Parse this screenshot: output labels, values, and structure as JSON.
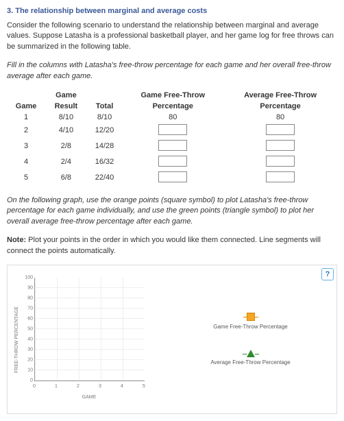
{
  "title": "3. The relationship between marginal and average costs",
  "intro": "Consider the following scenario to understand the relationship between marginal and average values. Suppose Latasha is a professional basketball player, and her game log for free throws can be summarized in the following table.",
  "fill_instr": "Fill in the columns with Latasha's free-throw percentage for each game and her overall free-throw average after each game.",
  "headers": {
    "game": "Game",
    "result_top": "Game",
    "result_bot": "Result",
    "total": "Total",
    "gpct_top": "Game Free-Throw",
    "gpct_bot": "Percentage",
    "apct_top": "Average Free-Throw",
    "apct_bot": "Percentage"
  },
  "rows": [
    {
      "game": "1",
      "result": "8/10",
      "total": "8/10",
      "gpct": "80",
      "apct": "80"
    },
    {
      "game": "2",
      "result": "4/10",
      "total": "12/20",
      "gpct": "",
      "apct": ""
    },
    {
      "game": "3",
      "result": "2/8",
      "total": "14/28",
      "gpct": "",
      "apct": ""
    },
    {
      "game": "4",
      "result": "2/4",
      "total": "16/32",
      "gpct": "",
      "apct": ""
    },
    {
      "game": "5",
      "result": "6/8",
      "total": "22/40",
      "gpct": "",
      "apct": ""
    }
  ],
  "graph_instr": "On the following graph, use the orange points (square symbol) to plot Latasha's free-throw percentage for each game individually, and use the green points (triangle symbol) to plot her overall average free-throw percentage after each game.",
  "note_label": "Note:",
  "note_text": " Plot your points in the order in which you would like them connected. Line segments will connect the points automatically.",
  "legend": {
    "game": "Game Free-Throw Percentage",
    "avg": "Average Free-Throw Percentage"
  },
  "axes": {
    "x": "GAME",
    "y": "FREE-THROW PERCENTAGE",
    "y_ticks": [
      "0",
      "10",
      "20",
      "30",
      "40",
      "50",
      "60",
      "70",
      "80",
      "90",
      "100"
    ],
    "x_ticks": [
      "0",
      "1",
      "2",
      "3",
      "4",
      "5"
    ]
  },
  "help": "?"
}
